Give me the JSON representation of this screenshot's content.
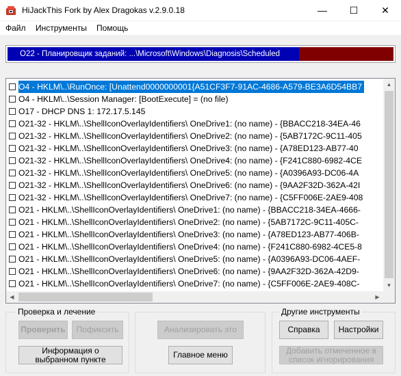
{
  "window": {
    "title": "HiJackThis Fork by Alex Dragokas v.2.9.0.18",
    "minimize_symbol": "—",
    "maximize_symbol": "☐",
    "close_symbol": "✕"
  },
  "menu": {
    "file": "Файл",
    "tools": "Инструменты",
    "help": "Помощь"
  },
  "status": {
    "text": "O22 - Планировщик заданий: ...\\Microsoft\\Windows\\Diagnosis\\Scheduled",
    "progress_fraction": 0.755,
    "fill_color": "#0000b4",
    "rest_color": "#800000"
  },
  "results": [
    {
      "text": "O4 - HKLM\\..\\RunOnce: [Unattend0000000001{A51CF3F7-91AC-4686-A579-BE3A6D54BB7",
      "selected": true
    },
    {
      "text": "O4 - HKLM\\..\\Session Manager: [BootExecute] = (no file)",
      "selected": false
    },
    {
      "text": "O17 - DHCP DNS 1: 172.17.5.145",
      "selected": false
    },
    {
      "text": "O21-32 - HKLM\\..\\ShellIconOverlayIdentifiers\\ OneDrive1: (no name) - {BBACC218-34EA-46",
      "selected": false
    },
    {
      "text": "O21-32 - HKLM\\..\\ShellIconOverlayIdentifiers\\ OneDrive2: (no name) - {5AB7172C-9C11-405",
      "selected": false
    },
    {
      "text": "O21-32 - HKLM\\..\\ShellIconOverlayIdentifiers\\ OneDrive3: (no name) - {A78ED123-AB77-40",
      "selected": false
    },
    {
      "text": "O21-32 - HKLM\\..\\ShellIconOverlayIdentifiers\\ OneDrive4: (no name) - {F241C880-6982-4CE",
      "selected": false
    },
    {
      "text": "O21-32 - HKLM\\..\\ShellIconOverlayIdentifiers\\ OneDrive5: (no name) - {A0396A93-DC06-4A",
      "selected": false
    },
    {
      "text": "O21-32 - HKLM\\..\\ShellIconOverlayIdentifiers\\ OneDrive6: (no name) - {9AA2F32D-362A-42I",
      "selected": false
    },
    {
      "text": "O21-32 - HKLM\\..\\ShellIconOverlayIdentifiers\\ OneDrive7: (no name) - {C5FF006E-2AE9-408",
      "selected": false
    },
    {
      "text": "O21 - HKLM\\..\\ShellIconOverlayIdentifiers\\ OneDrive1: (no name) - {BBACC218-34EA-4666-",
      "selected": false
    },
    {
      "text": "O21 - HKLM\\..\\ShellIconOverlayIdentifiers\\ OneDrive2: (no name) - {5AB7172C-9C11-405C-",
      "selected": false
    },
    {
      "text": "O21 - HKLM\\..\\ShellIconOverlayIdentifiers\\ OneDrive3: (no name) - {A78ED123-AB77-406B-",
      "selected": false
    },
    {
      "text": "O21 - HKLM\\..\\ShellIconOverlayIdentifiers\\ OneDrive4: (no name) - {F241C880-6982-4CE5-8",
      "selected": false
    },
    {
      "text": "O21 - HKLM\\..\\ShellIconOverlayIdentifiers\\ OneDrive5: (no name) - {A0396A93-DC06-4AEF-",
      "selected": false
    },
    {
      "text": "O21 - HKLM\\..\\ShellIconOverlayIdentifiers\\ OneDrive6: (no name) - {9AA2F32D-362A-42D9-",
      "selected": false
    },
    {
      "text": "O21 - HKLM\\..\\ShellIconOverlayIdentifiers\\ OneDrive7: (no name) - {C5FF006E-2AE9-408C-",
      "selected": false
    }
  ],
  "scrollbar": {
    "up": "▲",
    "down": "▼",
    "left": "◀",
    "right": "▶"
  },
  "groups": {
    "scan_fix": {
      "title": "Проверка и лечение",
      "scan_button": "Проверить",
      "fix_button": "Пофиксить",
      "info_button": "Информация о выбранном пункте"
    },
    "middle": {
      "analyze_button": "Анализировать это",
      "main_menu_button": "Главное меню"
    },
    "other_tools": {
      "title": "Другие инструменты",
      "help_button": "Справка",
      "settings_button": "Настройки",
      "add_ignore_button": "Добавить отмеченное в список игнорирования"
    }
  },
  "icons": {
    "app": "hijackthis-app-icon",
    "minimize": "minimize-icon",
    "maximize": "maximize-icon",
    "close": "close-icon"
  }
}
